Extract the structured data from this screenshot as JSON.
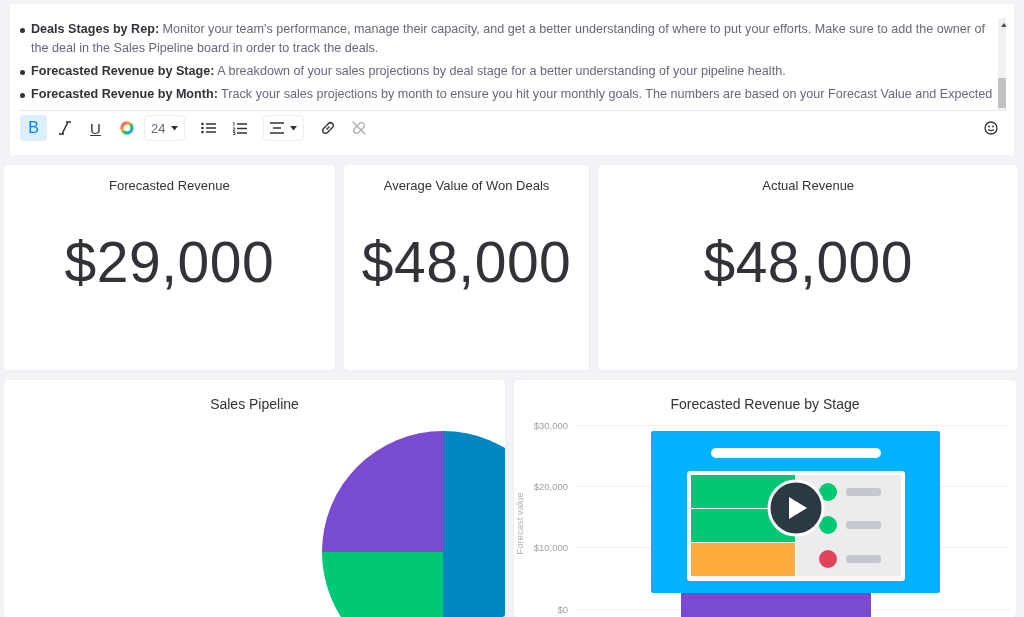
{
  "notes": {
    "bullets": [
      {
        "text": "**Deals Stages by Rep:** Monitor your team's performance, manage their capacity, and get a better understanding of where to put your efforts. Make sure to add the owner of the deal in the Sales Pipeline board in order to track the deals."
      },
      {
        "text": "**Forecasted Revenue by Stage:** A breakdown of your sales projections by deal stage for a better understanding of your pipeline health."
      },
      {
        "text": "**Forecasted Revenue by Month:** Track your sales projections by month to ensure you hit your monthly goals. The numbers are based on your Forecast Value and Expected"
      }
    ],
    "toolbar": [
      {
        "kind": "bold",
        "label": "B",
        "selected": true,
        "disabled": false
      },
      {
        "kind": "italic",
        "selected": false,
        "disabled": false
      },
      {
        "kind": "underline",
        "label": "U",
        "selected": false,
        "disabled": false
      },
      {
        "kind": "color",
        "selected": false,
        "disabled": false
      },
      {
        "kind": "size",
        "label": "24",
        "selected": false,
        "disabled": false
      },
      {
        "kind": "bullets",
        "selected": false,
        "disabled": false
      },
      {
        "kind": "numbers",
        "selected": false,
        "disabled": false
      },
      {
        "kind": "align",
        "selected": false,
        "disabled": false
      },
      {
        "kind": "link",
        "selected": false,
        "disabled": false
      },
      {
        "kind": "unlink",
        "selected": false,
        "disabled": true
      },
      {
        "kind": "emoji",
        "selected": false,
        "disabled": false
      }
    ]
  },
  "stats": [
    {
      "title": "Forecasted Revenue",
      "value": "$29,000"
    },
    {
      "title": "Average Value of Won Deals",
      "value": "$48,000"
    },
    {
      "title": "Actual Revenue",
      "value": "$48,000"
    }
  ],
  "sales_pipeline": {
    "title": "Sales Pipeline",
    "chart_data": {
      "type": "pie",
      "values": [
        50,
        25,
        25
      ],
      "colors": [
        "#0086c0",
        "#00c875",
        "#784bd1"
      ]
    }
  },
  "revenue_by_stage": {
    "title": "Forecasted Revenue by Stage",
    "ylabel": "Forecast value",
    "yticks": [
      "$30,000",
      "$20,000",
      "$10,000",
      "$0"
    ]
  }
}
